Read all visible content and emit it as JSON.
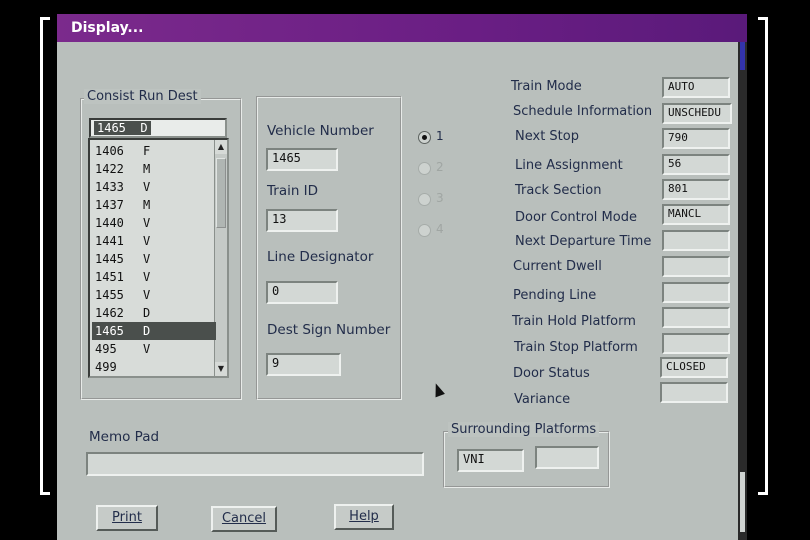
{
  "window": {
    "title": "Display..."
  },
  "consist": {
    "group_title": "Consist Run Dest",
    "selected_value": "1465  D",
    "items": [
      {
        "code": "1406",
        "dest": "F"
      },
      {
        "code": "1422",
        "dest": "M"
      },
      {
        "code": "1433",
        "dest": "V"
      },
      {
        "code": "1437",
        "dest": "M"
      },
      {
        "code": "1440",
        "dest": "V"
      },
      {
        "code": "1441",
        "dest": "V"
      },
      {
        "code": "1445",
        "dest": "V"
      },
      {
        "code": "1451",
        "dest": "V"
      },
      {
        "code": "1455",
        "dest": "V"
      },
      {
        "code": "1462",
        "dest": "D"
      },
      {
        "code": "1465",
        "dest": "D"
      },
      {
        "code": "495",
        "dest": "V"
      },
      {
        "code": "499",
        "dest": ""
      }
    ]
  },
  "vehicle": {
    "vehicle_number_label": "Vehicle Number",
    "vehicle_number": "1465",
    "train_id_label": "Train ID",
    "train_id": "13",
    "line_designator_label": "Line Designator",
    "line_designator": "0",
    "dest_sign_label": "Dest Sign Number",
    "dest_sign": "9"
  },
  "radios": [
    "1",
    "2",
    "3",
    "4"
  ],
  "status": {
    "train_mode_label": "Train Mode",
    "train_mode": "AUTO",
    "schedule_label": "Schedule Information",
    "schedule": "UNSCHEDU",
    "next_stop_label": "Next Stop",
    "next_stop": "790",
    "line_assignment_label": "Line Assignment",
    "line_assignment": "56",
    "track_section_label": "Track Section",
    "track_section": "801",
    "door_control_label": "Door Control Mode",
    "door_control": "MANCL",
    "next_departure_label": "Next Departure Time",
    "next_departure": "",
    "current_dwell_label": "Current Dwell",
    "current_dwell": "",
    "pending_line_label": "Pending Line",
    "pending_line": "",
    "train_hold_label": "Train Hold Platform",
    "train_hold": "",
    "train_stop_label": "Train Stop Platform",
    "train_stop": "",
    "door_status_label": "Door Status",
    "door_status": "CLOSED",
    "variance_label": "Variance",
    "variance": ""
  },
  "memo": {
    "label": "Memo Pad",
    "value": ""
  },
  "surrounding": {
    "title": "Surrounding Platforms",
    "left": "VNI",
    "right": ""
  },
  "buttons": {
    "print": "Print",
    "cancel": "Cancel",
    "help": "Help"
  }
}
